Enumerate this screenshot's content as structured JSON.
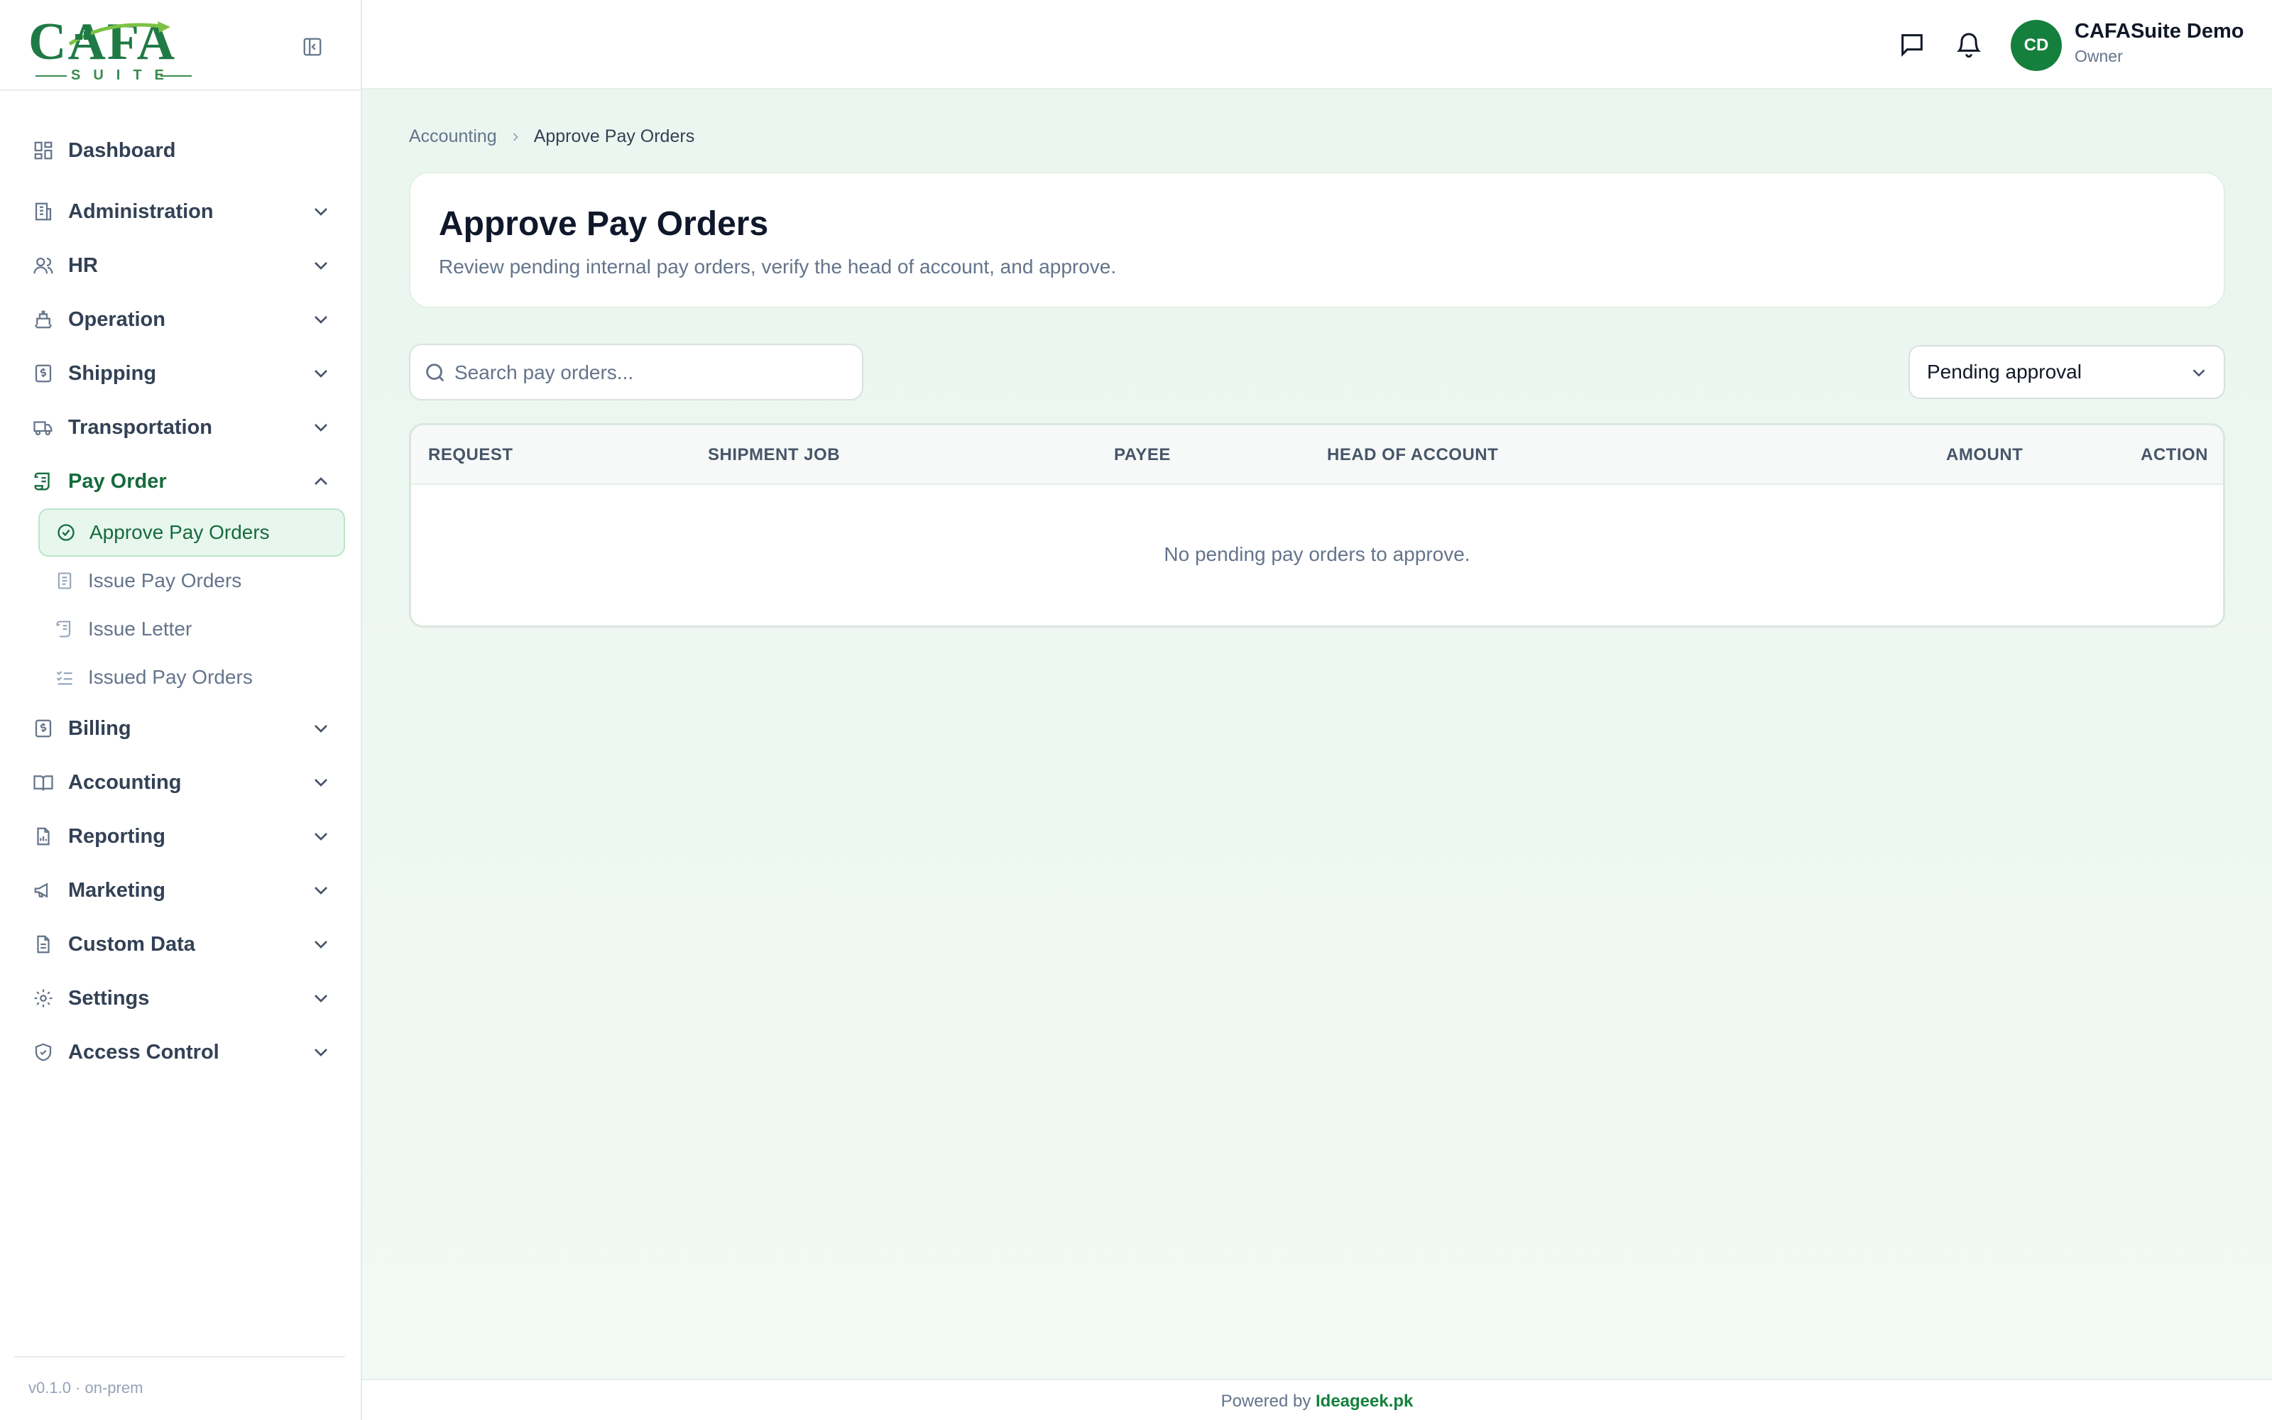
{
  "brand": {
    "logo_text": "CAFA",
    "logo_sub": "SUITE"
  },
  "sidebar": {
    "items": [
      {
        "label": "Dashboard",
        "icon": "dashboard-icon"
      },
      {
        "label": "Administration",
        "icon": "building-icon"
      },
      {
        "label": "HR",
        "icon": "users-icon"
      },
      {
        "label": "Operation",
        "icon": "ship-icon"
      },
      {
        "label": "Shipping",
        "icon": "dollar-document-icon"
      },
      {
        "label": "Transportation",
        "icon": "truck-icon"
      },
      {
        "label": "Pay Order",
        "icon": "scroll-icon",
        "expanded": true
      },
      {
        "label": "Billing",
        "icon": "dollar-document-icon"
      },
      {
        "label": "Accounting",
        "icon": "book-icon"
      },
      {
        "label": "Reporting",
        "icon": "report-icon"
      },
      {
        "label": "Marketing",
        "icon": "megaphone-icon"
      },
      {
        "label": "Custom Data",
        "icon": "data-file-icon"
      },
      {
        "label": "Settings",
        "icon": "gear-icon"
      },
      {
        "label": "Access Control",
        "icon": "shield-icon"
      }
    ],
    "pay_order_sub": [
      {
        "label": "Approve Pay Orders",
        "icon": "check-circle-icon",
        "active": true
      },
      {
        "label": "Issue Pay Orders",
        "icon": "document-icon"
      },
      {
        "label": "Issue Letter",
        "icon": "scroll-icon"
      },
      {
        "label": "Issued Pay Orders",
        "icon": "list-check-icon"
      }
    ],
    "version": "v0.1.0 · on-prem"
  },
  "header": {
    "user_initials": "CD",
    "user_name": "CAFASuite Demo",
    "user_role": "Owner"
  },
  "breadcrumb": {
    "parent": "Accounting",
    "current": "Approve Pay Orders"
  },
  "page": {
    "title": "Approve Pay Orders",
    "subtitle": "Review pending internal pay orders, verify the head of account, and approve."
  },
  "search": {
    "placeholder": "Search pay orders...",
    "value": ""
  },
  "filter": {
    "selected": "Pending approval"
  },
  "table": {
    "columns": [
      "REQUEST",
      "SHIPMENT JOB",
      "PAYEE",
      "HEAD OF ACCOUNT",
      "AMOUNT",
      "ACTION"
    ],
    "rows": [],
    "empty_message": "No pending pay orders to approve."
  },
  "footer": {
    "prefix": "Powered by",
    "link": "Ideageek.pk"
  },
  "colors": {
    "brand_green": "#15803d",
    "active_bg": "#e8f7ee",
    "main_bg": "#ebf6f0"
  }
}
